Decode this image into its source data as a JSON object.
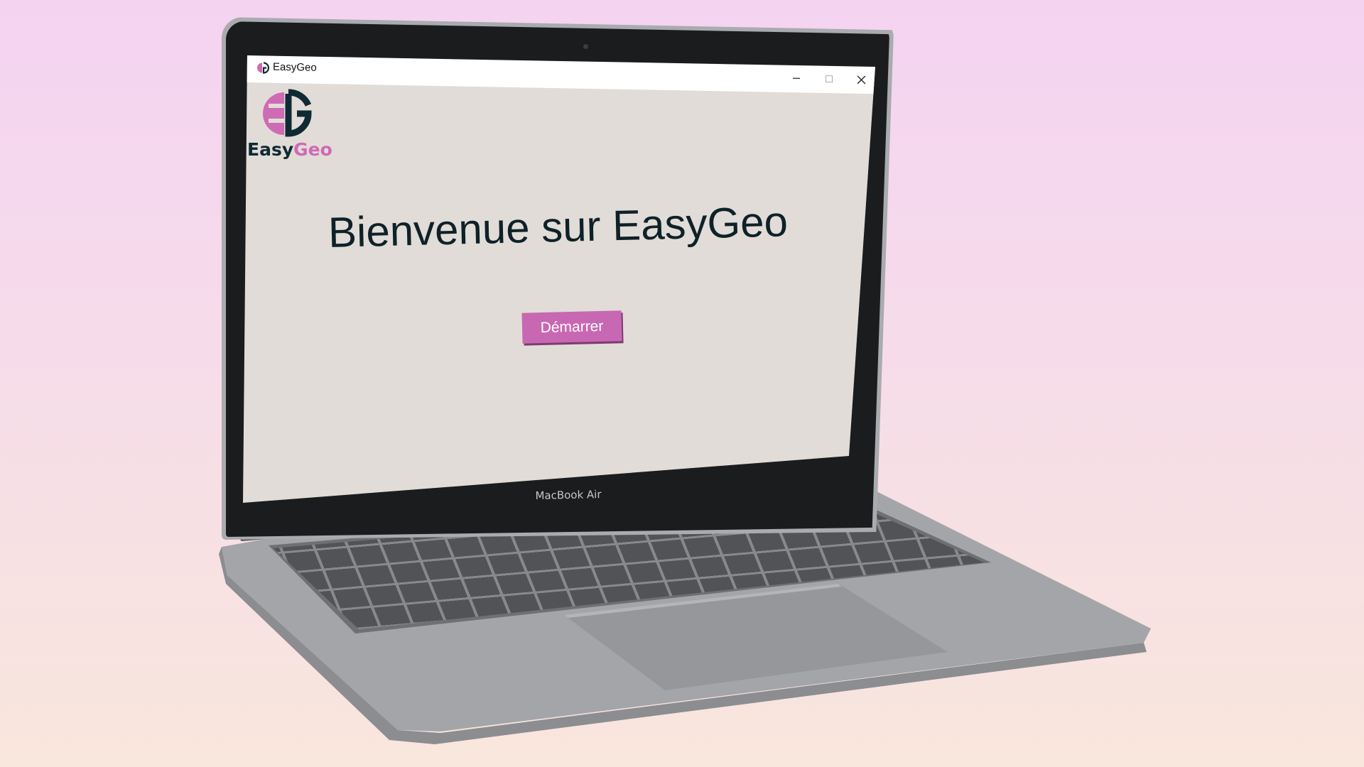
{
  "window": {
    "title": "EasyGeo",
    "controls": [
      "minimize-icon",
      "maximize-icon",
      "close-icon"
    ]
  },
  "logo": {
    "text_part1": "Easy",
    "text_part2": "Geo",
    "colors": {
      "dark": "#0f2a33",
      "pink": "#cf6ab5"
    }
  },
  "main": {
    "heading": "Bienvenue sur EasyGeo",
    "start_button": "Démarrer"
  },
  "device": {
    "label": "MacBook Air"
  },
  "colors": {
    "window_background": "#e1dcd7",
    "button": "#c868b3",
    "heading_text": "#0f2128"
  }
}
